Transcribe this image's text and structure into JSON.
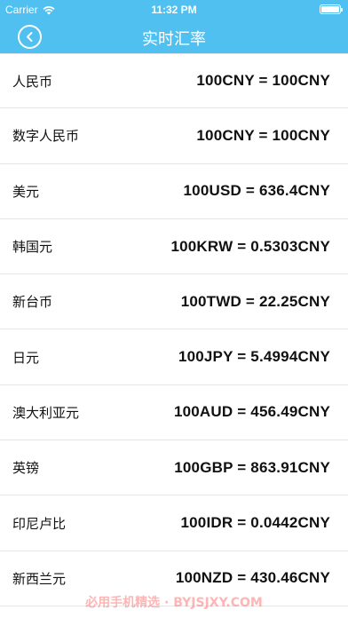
{
  "status_bar": {
    "carrier": "Carrier",
    "time": "11:32 PM",
    "battery_level": 1.0
  },
  "nav": {
    "title": "实时汇率",
    "back_icon": "chevron-left-circle-icon",
    "bar_color": "#4fc0f0"
  },
  "rates": [
    {
      "name": "人民币",
      "value": "100CNY = 100CNY"
    },
    {
      "name": "数字人民币",
      "value": "100CNY = 100CNY"
    },
    {
      "name": "美元",
      "value": "100USD = 636.4CNY"
    },
    {
      "name": "韩国元",
      "value": "100KRW = 0.5303CNY"
    },
    {
      "name": "新台币",
      "value": "100TWD = 22.25CNY"
    },
    {
      "name": "日元",
      "value": "100JPY = 5.4994CNY"
    },
    {
      "name": "澳大利亚元",
      "value": "100AUD = 456.49CNY"
    },
    {
      "name": "英镑",
      "value": "100GBP = 863.91CNY"
    },
    {
      "name": "印尼卢比",
      "value": "100IDR = 0.0442CNY"
    },
    {
      "name": "新西兰元",
      "value": "100NZD = 430.46CNY"
    }
  ],
  "watermark": "必用手机精选 · BYJSJXY.COM"
}
